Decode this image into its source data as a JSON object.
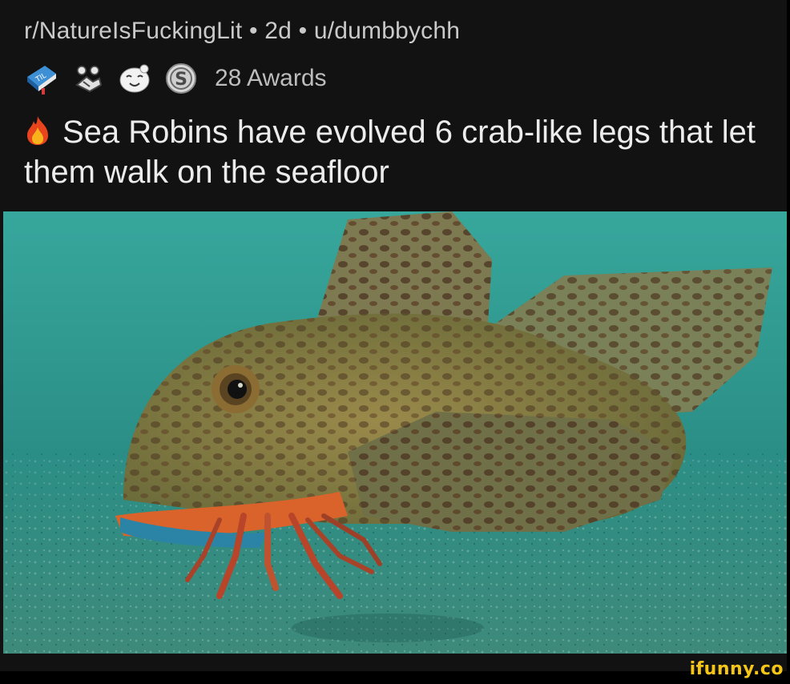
{
  "post": {
    "subreddit": "r/NatureIsFuckingLit",
    "separator": "•",
    "age": "2d",
    "author": "u/dumbbychh",
    "awards": {
      "icons": [
        "book-award-icon",
        "handshake-award-icon",
        "smiling-face-award-icon",
        "silver-coin-award-icon"
      ],
      "count_label": "28 Awards"
    },
    "title_emoji": "fire-icon",
    "title": "Sea Robins have evolved 6 crab-like legs that let them walk on the seafloor"
  },
  "media": {
    "type": "image",
    "subject": "sea-robin-fish-photo"
  },
  "watermark": {
    "text": "ifunny.co",
    "color": "#f5c518"
  },
  "colors": {
    "background": "#121212",
    "meta_text": "#c9c9c9",
    "title_text": "#ececec",
    "water": "#2a8c80"
  }
}
